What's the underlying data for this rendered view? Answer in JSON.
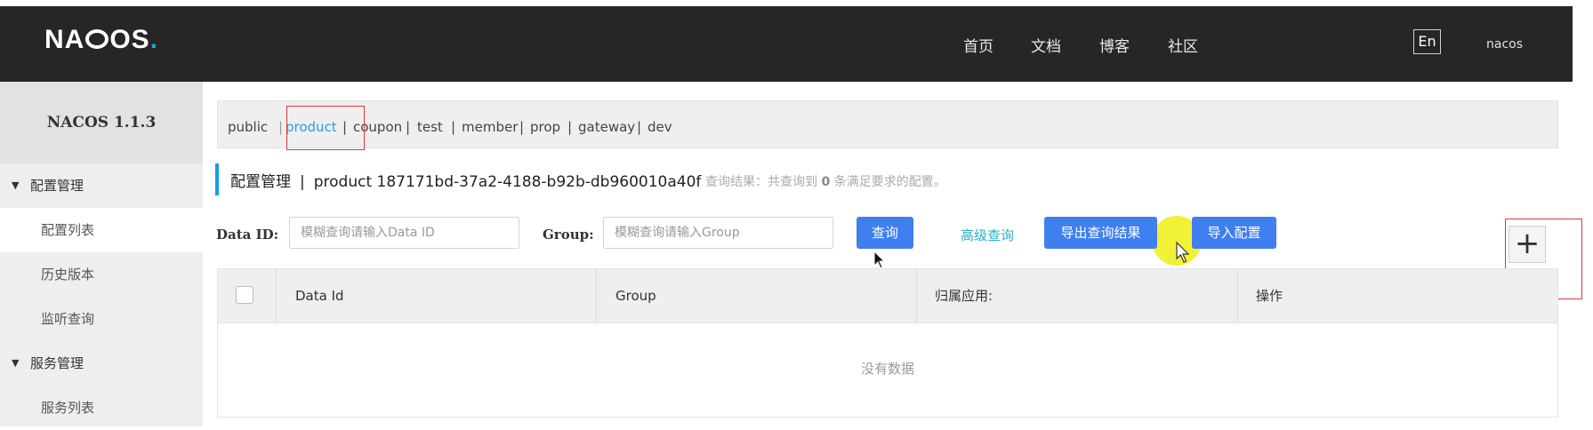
{
  "header": {
    "logo_text": "NACOS",
    "nav": [
      "首页",
      "文档",
      "博客",
      "社区"
    ],
    "lang_button": "En",
    "user": "nacos"
  },
  "sidebar": {
    "version": "NACOS 1.1.3",
    "groups": [
      {
        "label": "配置管理",
        "items": [
          "配置列表",
          "历史版本",
          "监听查询"
        ]
      },
      {
        "label": "服务管理",
        "items": [
          "服务列表"
        ]
      }
    ]
  },
  "namespaces": [
    "public",
    "product",
    "coupon",
    "test",
    "member",
    "prop",
    "gateway",
    "dev"
  ],
  "active_namespace": "product",
  "page": {
    "title": "配置管理",
    "separator": "|",
    "namespace": "product",
    "namespace_id": "187171bd-37a2-4188-b92b-db960010a40f",
    "query_result_prefix": "查询结果：共查询到",
    "query_result_count": "0",
    "query_result_suffix": "条满足要求的配置。"
  },
  "filters": {
    "data_id_label": "Data ID:",
    "data_id_placeholder": "模糊查询请输入Data ID",
    "group_label": "Group:",
    "group_placeholder": "模糊查询请输入Group",
    "query_button": "查询",
    "advanced_query": "高级查询",
    "export_button": "导出查询结果",
    "import_button": "导入配置"
  },
  "table": {
    "columns": [
      "Data Id",
      "Group",
      "归属应用:",
      "操作"
    ],
    "empty_text": "没有数据"
  },
  "colors": {
    "header_bg": "#262626",
    "accent": "#3f7fef",
    "active_tab": "#2a9fd6",
    "annotation": "#e23434"
  }
}
